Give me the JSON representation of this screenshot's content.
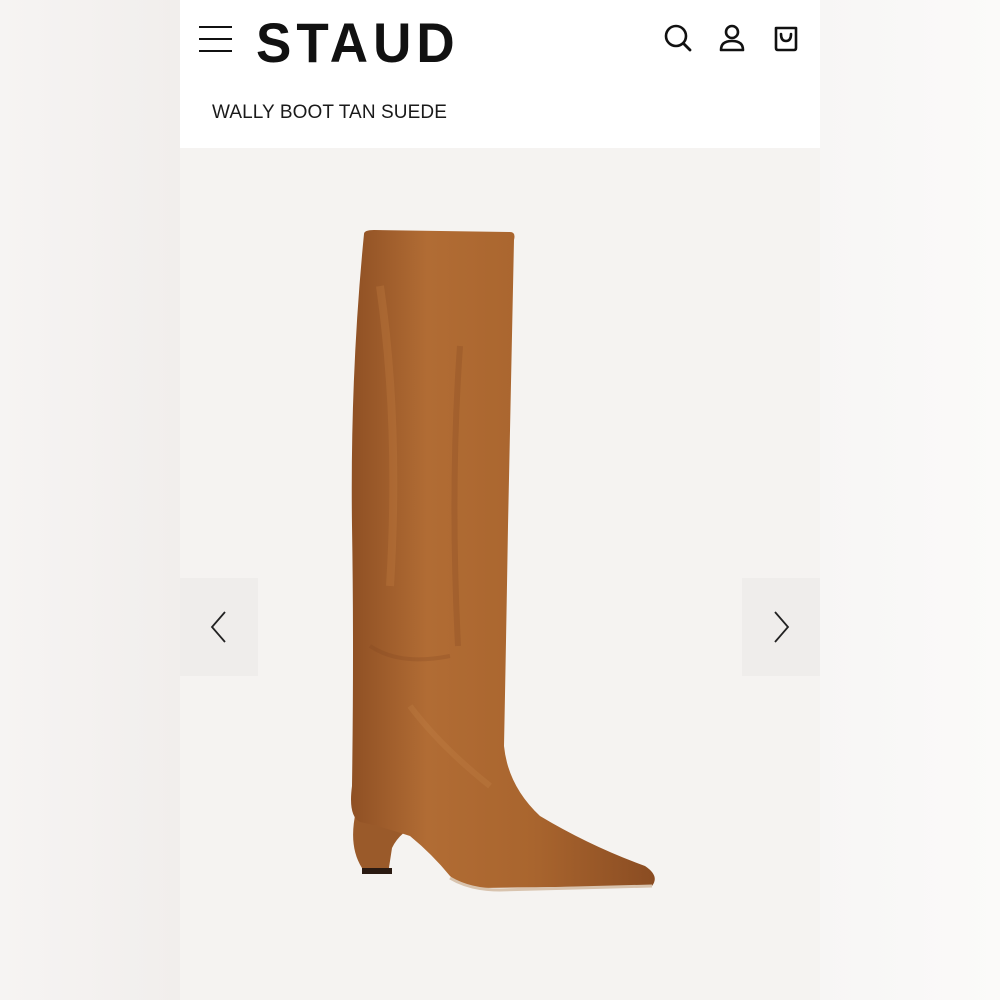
{
  "brand": {
    "name": "STAUD"
  },
  "header": {
    "menu_icon": "hamburger-menu-icon",
    "search_icon": "search-icon",
    "account_icon": "user-icon",
    "cart_icon": "shopping-bag-icon"
  },
  "product": {
    "title": "WALLY BOOT TAN SUEDE",
    "color": "#a9652e"
  },
  "gallery": {
    "prev_icon": "chevron-left-icon",
    "next_icon": "chevron-right-icon"
  }
}
